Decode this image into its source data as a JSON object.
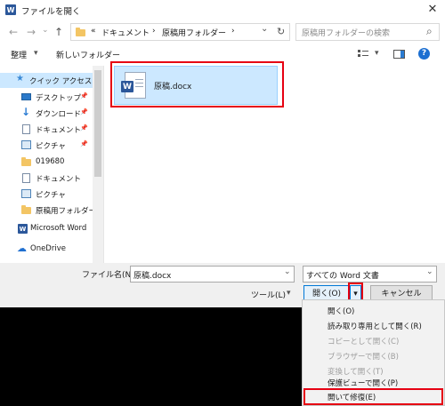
{
  "window": {
    "title": "ファイルを開く",
    "app_icon": "word-icon",
    "close_glyph": "✕"
  },
  "nav": {
    "back": "←",
    "forward": "→",
    "dropdown": "⌄",
    "up": "↑",
    "breadcrumb": [
      "«",
      "ドキュメント",
      "›",
      "原稿用フォルダー",
      "›"
    ],
    "address_dropdown": "⌄",
    "refresh": "↻",
    "search_placeholder": "原稿用フォルダーの検索",
    "search_glyph": "⌕"
  },
  "toolbar": {
    "organize": "整理",
    "organize_caret": "▾",
    "new_folder": "新しいフォルダー",
    "view_caret": "▾",
    "help": "?"
  },
  "sidebar": {
    "items": [
      {
        "label": "クイック アクセス",
        "icon": "star-icon"
      },
      {
        "label": "デスクトップ",
        "icon": "desktop-icon",
        "pin": "📌"
      },
      {
        "label": "ダウンロード",
        "icon": "download-icon",
        "pin": "📌"
      },
      {
        "label": "ドキュメント",
        "icon": "documents-icon",
        "pin": "📌"
      },
      {
        "label": "ピクチャ",
        "icon": "pictures-icon",
        "pin": "📌"
      },
      {
        "label": "019680",
        "icon": "folder-icon"
      },
      {
        "label": "ドキュメント",
        "icon": "documents-icon"
      },
      {
        "label": "ピクチャ",
        "icon": "pictures-icon"
      },
      {
        "label": "原稿用フォルダー",
        "icon": "folder-icon"
      },
      {
        "label": "Microsoft Word",
        "icon": "word-icon"
      },
      {
        "label": "OneDrive",
        "icon": "onedrive-icon"
      }
    ]
  },
  "file_list": {
    "items": [
      {
        "name": "原稿.docx",
        "icon": "word-document-icon",
        "selected": true
      }
    ]
  },
  "footer": {
    "filename_label": "ファイル名(N):",
    "filename_value": "原稿.docx",
    "filetype_value": "すべての Word 文書",
    "tools_label": "ツール(L)",
    "tools_caret": "▾",
    "open_label": "開く(O)",
    "open_caret": "▾",
    "cancel_label": "キャンセル"
  },
  "open_menu": {
    "items": [
      {
        "label": "開く(O)",
        "enabled": true
      },
      {
        "label": "読み取り専用として開く(R)",
        "enabled": true
      },
      {
        "label": "コピーとして開く(C)",
        "enabled": false
      },
      {
        "label": "ブラウザーで開く(B)",
        "enabled": false
      },
      {
        "label": "変換して開く(T)",
        "enabled": false
      },
      {
        "label": "保護ビューで開く(P)",
        "enabled": true
      },
      {
        "label": "開いて修復(E)",
        "enabled": true
      }
    ]
  },
  "colors": {
    "accent_blue": "#0078d7",
    "selection": "#cce8ff",
    "highlight_red": "#e60012",
    "word_blue": "#2b579a"
  }
}
